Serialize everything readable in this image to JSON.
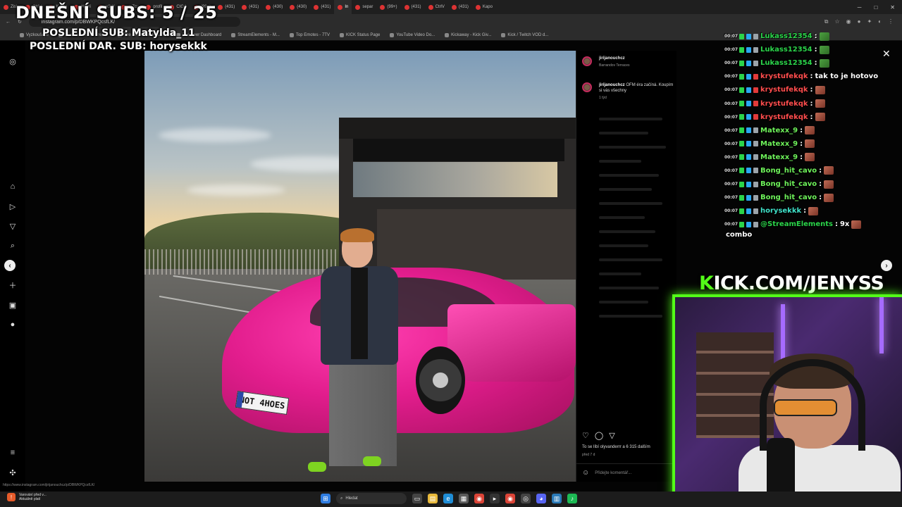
{
  "overlay": {
    "subs_goal": "DNEŠNÍ SUBS: 5 / 25",
    "last_sub": "POSLEDNÍ SUB: Matylda_11",
    "last_dar_sub": "POSLEDNÍ DAR. SUB: horysekkk",
    "kick_url_k": "K",
    "kick_url_rest": "ICK.COM/JENYSS"
  },
  "browser": {
    "tabs": [
      "Zisk",
      "CtrlV",
      "Kuwis",
      "Havlí",
      "w3W",
      "mZcu",
      "profil",
      "CIGA",
      "(99+)",
      "(431)",
      "(431)",
      "(430)",
      "(430)",
      "(431)",
      "In",
      "separ",
      "(99+)",
      "(431)",
      "CtrlV",
      "(431)",
      "Kapo"
    ],
    "active_tab_index": 14,
    "url": "instagram.com/p/DBWKPQcsfLK/",
    "bookmarks": [
      "Vyzkoušejte",
      "File Converter - Free...",
      "The best ChatBot an...",
      "Streamer Dashboard",
      "StreamElements - M...",
      "Top Emotes - 7TV",
      "KICK Status Page",
      "YouTube Video Do...",
      "Kickaway - Kick Giv...",
      "Kick / Twitch VOD d..."
    ]
  },
  "post": {
    "username": "jirijanouchcz",
    "location": "Barrandov Terraces",
    "caption_user": "jirijanouchcz",
    "caption_text": "OFM éra začíná. Koupím si vás všechny",
    "caption_time": "1 týd",
    "plate": "NOT 4HOES",
    "likes": "To se líbí olyvanderrr a 6 315 dalším",
    "posted": "před 7 d",
    "comment_placeholder": "Přidejte komentář..."
  },
  "chat": {
    "messages": [
      {
        "time": "00:07",
        "user": "Lukass12354",
        "color": "#2bd44a",
        "text": "",
        "emote": "mobile"
      },
      {
        "time": "00:07",
        "user": "Lukass12354",
        "color": "#2bd44a",
        "text": "",
        "emote": "mobile"
      },
      {
        "time": "00:07",
        "user": "Lukass12354",
        "color": "#2bd44a",
        "text": "",
        "emote": "mobile"
      },
      {
        "time": "00:07",
        "user": "krystufekqk",
        "color": "#ff4d4d",
        "text": "tak to je hotovo",
        "emote": ""
      },
      {
        "time": "00:07",
        "user": "krystufekqk",
        "color": "#ff4d4d",
        "text": "",
        "emote": "face"
      },
      {
        "time": "00:07",
        "user": "krystufekqk",
        "color": "#ff4d4d",
        "text": "",
        "emote": "face"
      },
      {
        "time": "00:07",
        "user": "krystufekqk",
        "color": "#ff4d4d",
        "text": "",
        "emote": "face"
      },
      {
        "time": "00:07",
        "user": "Matexx_9",
        "color": "#6ef25a",
        "text": "",
        "emote": "face"
      },
      {
        "time": "00:07",
        "user": "Matexx_9",
        "color": "#6ef25a",
        "text": "",
        "emote": "face"
      },
      {
        "time": "00:07",
        "user": "Matexx_9",
        "color": "#6ef25a",
        "text": "",
        "emote": "face"
      },
      {
        "time": "00:07",
        "user": "Bong_hit_cavo",
        "color": "#6ef25a",
        "text": "",
        "emote": "face"
      },
      {
        "time": "00:07",
        "user": "Bong_hit_cavo",
        "color": "#6ef25a",
        "text": "",
        "emote": "face"
      },
      {
        "time": "00:07",
        "user": "Bong_hit_cavo",
        "color": "#6ef25a",
        "text": "",
        "emote": "face"
      },
      {
        "time": "00:07",
        "user": "horysekkk",
        "color": "#3fe0c8",
        "text": "",
        "emote": "face"
      },
      {
        "time": "00:07",
        "user": "@StreamElements",
        "color": "#2bd44a",
        "text": "9x",
        "emote": "face"
      }
    ],
    "combo": "combo"
  },
  "statusbar": {
    "url": "https://www.instagram.com/jirijanouchcz/p/DBWKPQcsfLK/"
  },
  "taskbar": {
    "notif_title": "Varování před v...",
    "notif_sub": "Aktuálně platí",
    "search": "Hledat"
  }
}
